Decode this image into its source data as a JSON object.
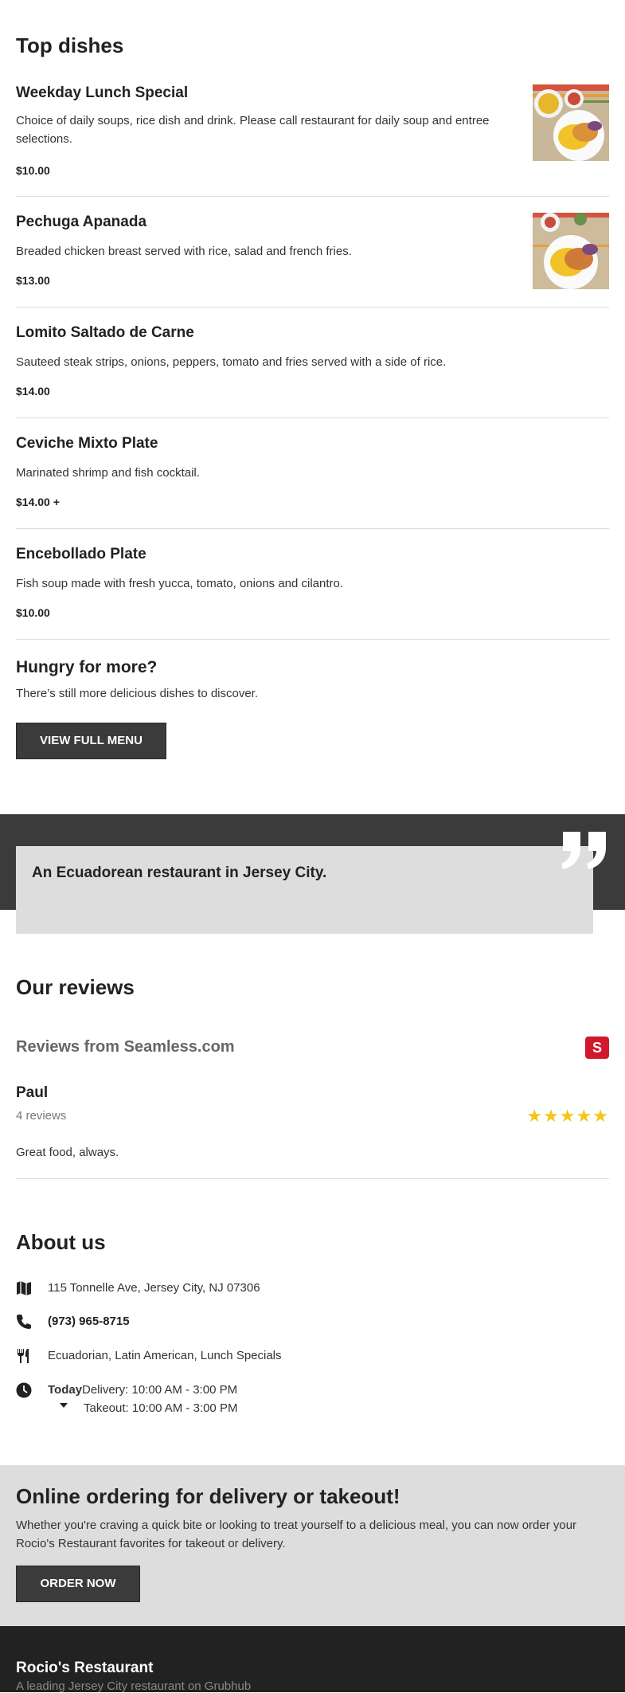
{
  "top_dishes": {
    "title": "Top dishes",
    "items": [
      {
        "name": "Weekday Lunch Special",
        "description": "Choice of daily soups, rice dish and drink. Please call restaurant for daily soup and entree selections.",
        "price": "$10.00"
      },
      {
        "name": "Pechuga Apanada",
        "description": "Breaded chicken breast served with rice, salad and french fries.",
        "price": "$13.00"
      },
      {
        "name": "Lomito Saltado de Carne",
        "description": "Sauteed steak strips, onions, peppers, tomato and fries served with a side of rice.",
        "price": "$14.00"
      },
      {
        "name": "Ceviche Mixto Plate",
        "description": "Marinated shrimp and fish cocktail.",
        "price": "$14.00 +"
      },
      {
        "name": "Encebollado Plate",
        "description": "Fish soup made with fresh yucca, tomato, onions and cilantro.",
        "price": "$10.00"
      }
    ]
  },
  "hungry": {
    "title": "Hungry for more?",
    "subtitle": "There’s still more delicious dishes to discover.",
    "button_label": "VIEW FULL MENU"
  },
  "quote": {
    "text": "An Ecuadorean restaurant in Jersey City.",
    "icon": "quote-mark-icon"
  },
  "reviews": {
    "title": "Our reviews",
    "source": "Reviews from Seamless.com",
    "source_logo_letter": "S",
    "source_logo_color": "#d1182d",
    "reviewer": "Paul",
    "reviewer_count": "4 reviews",
    "rating": 5,
    "rating_max": 5,
    "text": "Great food, always."
  },
  "about": {
    "title": "About us",
    "address": "115 Tonnelle Ave, Jersey City, NJ 07306",
    "phone": "(973) 965-8715",
    "cuisines": "Ecuadorian, Latin American, Lunch Specials",
    "hours_day": "Today",
    "delivery_hours": "Delivery: 10:00 AM - 3:00 PM",
    "takeout_hours": "Takeout: 10:00 AM - 3:00 PM"
  },
  "order": {
    "title": "Online ordering for delivery or takeout!",
    "description": "Whether you're craving a quick bite or looking to treat yourself to a delicious meal, you can now order your Rocio's Restaurant favorites for takeout or delivery.",
    "button_label": "ORDER NOW"
  },
  "footer": {
    "name": "Rocio's Restaurant",
    "tagline": "A leading Jersey City restaurant on Grubhub"
  },
  "colors": {
    "dark_band": "#3b3b3b",
    "light_band": "#dddddd",
    "footer": "#222222",
    "star": "#f5c518"
  }
}
